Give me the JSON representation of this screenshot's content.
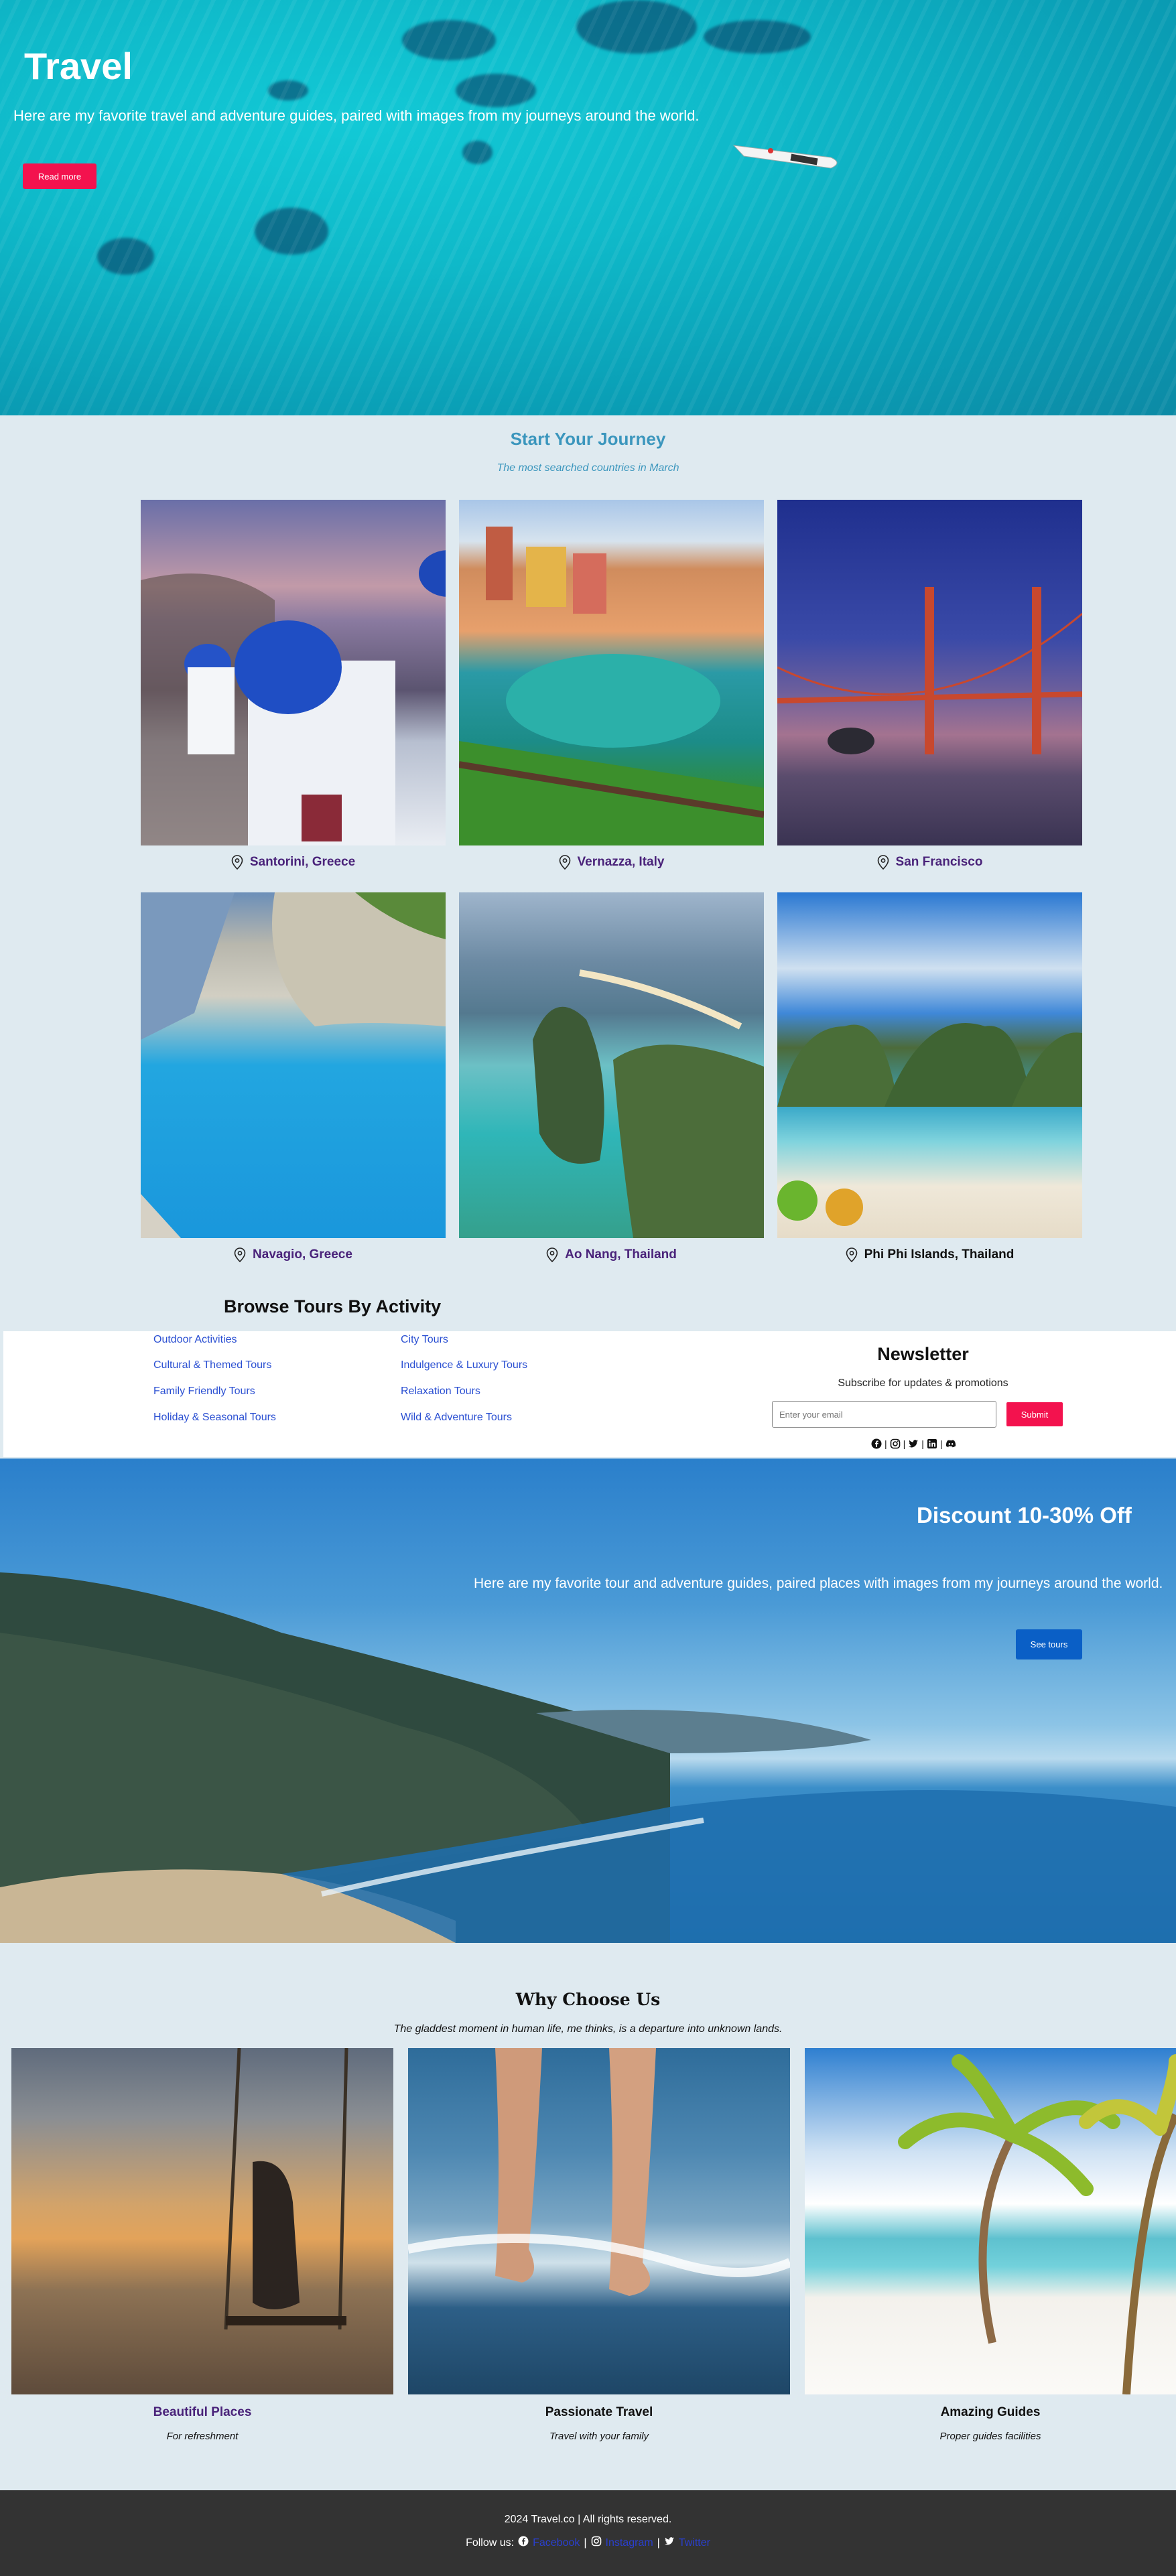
{
  "hero": {
    "title": "Travel",
    "subtitle": "Here are my favorite travel and adventure guides, paired with images from my journeys around the world.",
    "button": "Read more"
  },
  "journey": {
    "title": "Start Your Journey",
    "subtitle": "The most searched countries in March",
    "destinations": [
      {
        "name": "Santorini, Greece"
      },
      {
        "name": "Vernazza, Italy"
      },
      {
        "name": "San Francisco"
      },
      {
        "name": "Navagio, Greece"
      },
      {
        "name": "Ao Nang, Thailand"
      },
      {
        "name": "Phi Phi Islands, Thailand"
      }
    ]
  },
  "browse": {
    "title": "Browse Tours By Activity",
    "col1": [
      "Outdoor Activities",
      "Cultural & Themed Tours",
      "Family Friendly Tours",
      "Holiday & Seasonal Tours"
    ],
    "col2": [
      "City Tours",
      "Indulgence & Luxury Tours",
      "Relaxation Tours",
      "Wild & Adventure Tours"
    ]
  },
  "newsletter": {
    "title": "Newsletter",
    "subtitle": "Subscribe for updates & promotions",
    "placeholder": "Enter your email",
    "button": "Submit",
    "socials": [
      "facebook-icon",
      "instagram-icon",
      "twitter-icon",
      "linkedin-icon",
      "discord-icon"
    ]
  },
  "discount": {
    "title": "Discount 10-30% Off",
    "subtitle": "Here are my favorite tour and adventure guides, paired places with images from my journeys around the world.",
    "button": "See tours"
  },
  "why": {
    "title": "Why Choose Us",
    "subtitle": "The gladdest moment in human life, me thinks, is a departure into unknown lands.",
    "items": [
      {
        "heading": "Beautiful Places",
        "text": "For refreshment"
      },
      {
        "heading": "Passionate Travel",
        "text": "Travel with your family"
      },
      {
        "heading": "Amazing Guides",
        "text": "Proper guides facilities"
      }
    ]
  },
  "footer": {
    "copyright": "2024 Travel.co | All rights reserved.",
    "follow": "Follow us:",
    "links": [
      "Facebook",
      "Instagram",
      "Twitter"
    ]
  },
  "colors": {
    "accent_red": "#f3124e",
    "heading_teal": "#3b96bd",
    "destination_purple": "#4a237a",
    "link_blue": "#2a4fd2",
    "button_blue": "#0a5fc6",
    "footer_bg": "#333333"
  }
}
